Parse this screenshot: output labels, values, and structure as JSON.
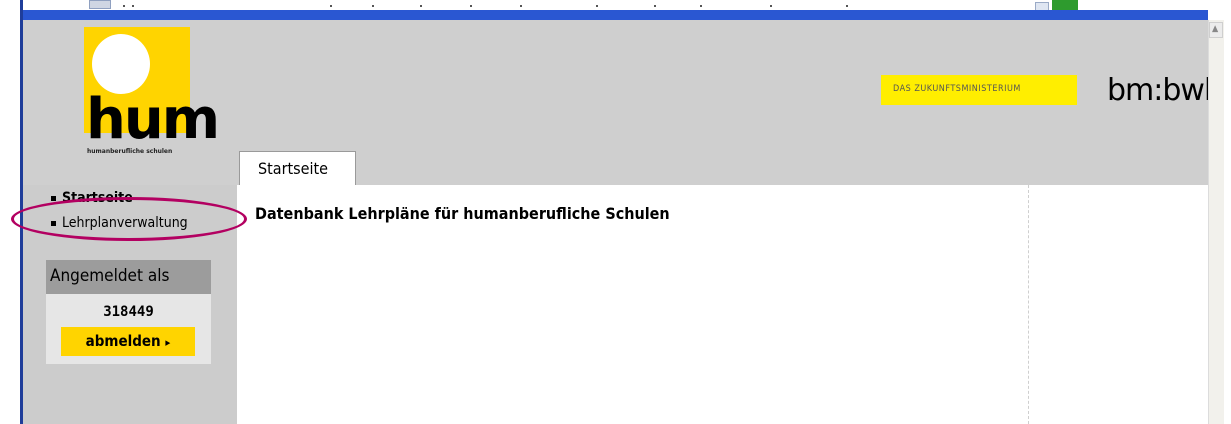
{
  "header": {
    "logo_text": "hum",
    "logo_subtitle": "humanberufliche schulen",
    "ministry_text": "DAS ZUKUNFTSMINISTERIUM",
    "brand": "bm:bwk"
  },
  "tabs": [
    {
      "label": "Startseite",
      "active": true
    }
  ],
  "sidebar": {
    "items": [
      {
        "label": "Startseite"
      },
      {
        "label": "Lehrplanverwaltung",
        "highlighted": true
      }
    ],
    "login": {
      "heading": "Angemeldet als",
      "user_id": "318449",
      "logout_label": "abmelden"
    }
  },
  "main": {
    "title": "Datenbank Lehrpläne für humanberufliche Schulen"
  },
  "colors": {
    "brand_yellow": "#ffd400",
    "ministry_yellow": "#ffee00",
    "header_gray": "#cfcfcf",
    "sidebar_gray": "#cccccc",
    "highlight_magenta": "#b30061"
  },
  "icons": {
    "nav_bullet": "square-bullet-icon",
    "logout_arrow": "chevron-right-icon",
    "scroll_up": "scroll-up-arrow-icon"
  }
}
